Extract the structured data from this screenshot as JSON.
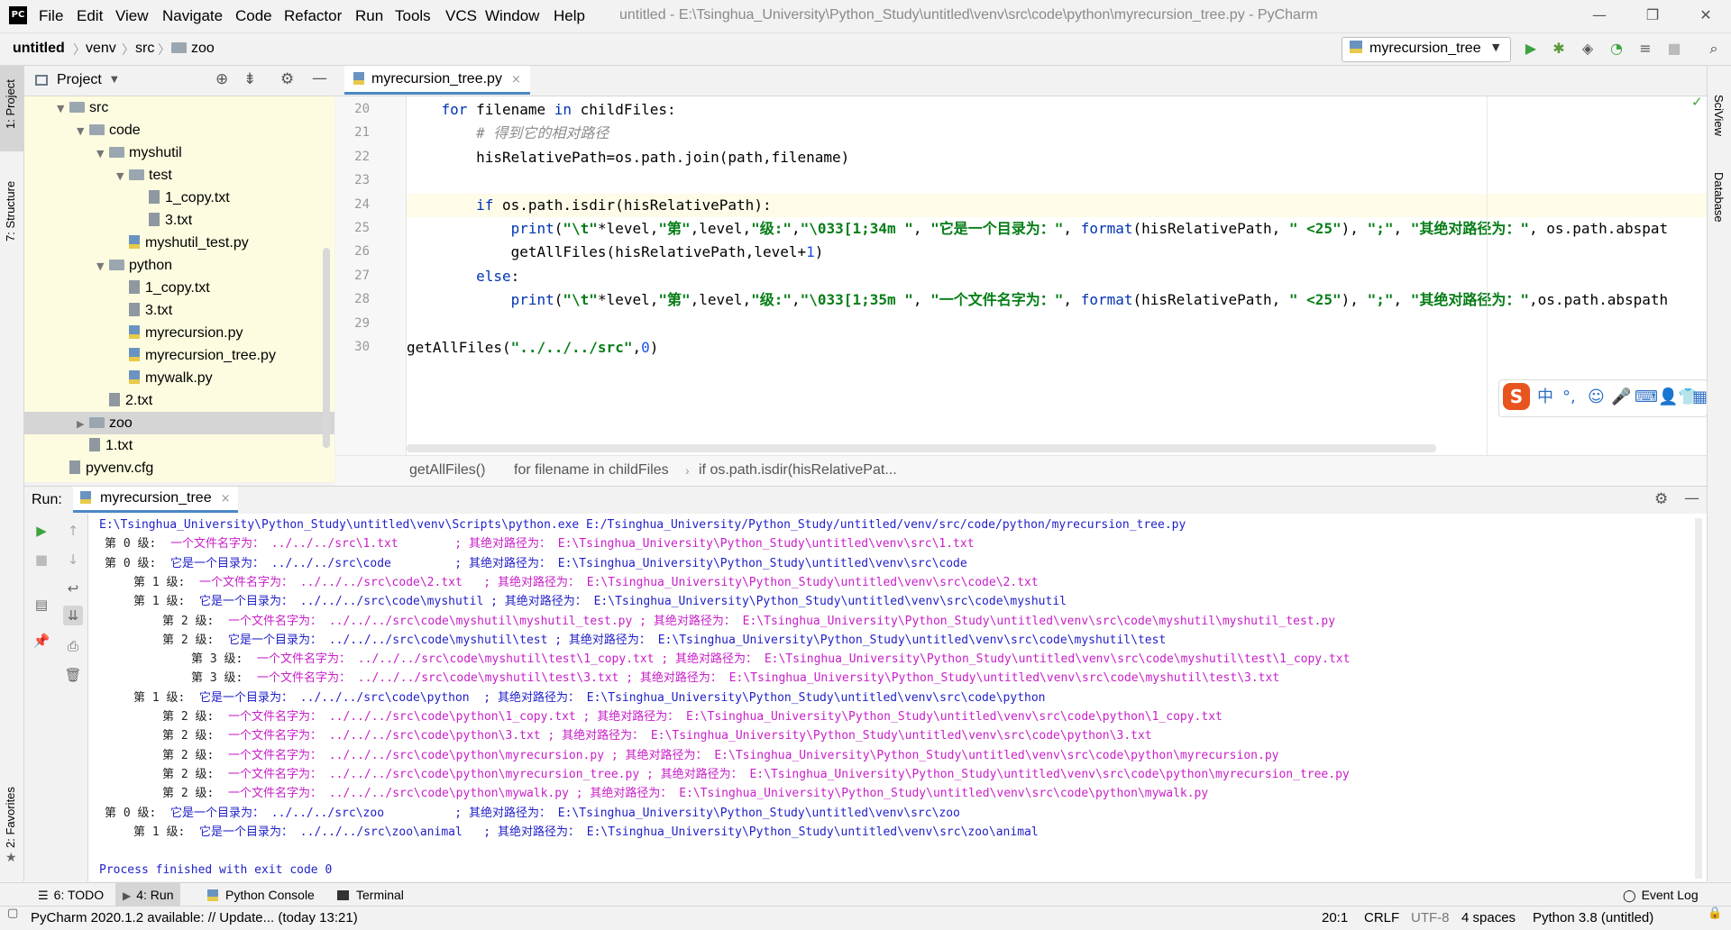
{
  "window": {
    "logo": "PC",
    "title": "untitled - E:\\Tsinghua_University\\Python_Study\\untitled\\venv\\src\\code\\python\\myrecursion_tree.py - PyCharm",
    "menu": [
      "File",
      "Edit",
      "View",
      "Navigate",
      "Code",
      "Refactor",
      "Run",
      "Tools",
      "VCS",
      "Window",
      "Help"
    ]
  },
  "navbar": {
    "crumbs": [
      "untitled",
      "venv",
      "src",
      "zoo"
    ],
    "run_config": "myrecursion_tree"
  },
  "left_stripe": {
    "project": "1: Project",
    "structure": "7: Structure",
    "favorites": "2: Favorites"
  },
  "right_stripe": {
    "sciview": "SciView",
    "database": "Database"
  },
  "project": {
    "title": "Project",
    "tree": [
      {
        "label": "src",
        "depth": 3,
        "type": "folder",
        "open": true
      },
      {
        "label": "code",
        "depth": 4,
        "type": "folder",
        "open": true
      },
      {
        "label": "myshutil",
        "depth": 5,
        "type": "folder",
        "open": true
      },
      {
        "label": "test",
        "depth": 6,
        "type": "folder",
        "open": true
      },
      {
        "label": "1_copy.txt",
        "depth": 7,
        "type": "txt"
      },
      {
        "label": "3.txt",
        "depth": 7,
        "type": "txt"
      },
      {
        "label": "myshutil_test.py",
        "depth": 6,
        "type": "py"
      },
      {
        "label": "python",
        "depth": 5,
        "type": "folder",
        "open": true
      },
      {
        "label": "1_copy.txt",
        "depth": 6,
        "type": "txt"
      },
      {
        "label": "3.txt",
        "depth": 6,
        "type": "txt"
      },
      {
        "label": "myrecursion.py",
        "depth": 6,
        "type": "py"
      },
      {
        "label": "myrecursion_tree.py",
        "depth": 6,
        "type": "py"
      },
      {
        "label": "mywalk.py",
        "depth": 6,
        "type": "py"
      },
      {
        "label": "2.txt",
        "depth": 5,
        "type": "txt"
      },
      {
        "label": "zoo",
        "depth": 4,
        "type": "folder",
        "open": false,
        "selected": true
      },
      {
        "label": "1.txt",
        "depth": 4,
        "type": "txt"
      },
      {
        "label": "pyvenv.cfg",
        "depth": 3,
        "type": "cfg"
      }
    ]
  },
  "editor": {
    "tab": "myrecursion_tree.py",
    "line_numbers": [
      "20",
      "21",
      "22",
      "23",
      "24",
      "25",
      "26",
      "27",
      "28",
      "29",
      "30"
    ],
    "lines": [
      [
        {
          "t": "    "
        },
        {
          "t": "for",
          "c": "kw"
        },
        {
          "t": " filename "
        },
        {
          "t": "in",
          "c": "kw"
        },
        {
          "t": " childFiles:"
        }
      ],
      [
        {
          "t": "        "
        },
        {
          "t": "# 得到它的相对路径",
          "c": "cm"
        }
      ],
      [
        {
          "t": "        hisRelativePath=os.path.join(path,filename)"
        }
      ],
      [
        {
          "t": ""
        }
      ],
      [
        {
          "t": "        "
        },
        {
          "t": "if",
          "c": "kw"
        },
        {
          "t": " os.path.isdir(hisRelativePath):"
        }
      ],
      [
        {
          "t": "            "
        },
        {
          "t": "print",
          "c": "kw"
        },
        {
          "t": "("
        },
        {
          "t": "\"\\t\"",
          "c": "str"
        },
        {
          "t": "*level,"
        },
        {
          "t": "\"第\"",
          "c": "str"
        },
        {
          "t": ",level,"
        },
        {
          "t": "\"级:\"",
          "c": "str"
        },
        {
          "t": ","
        },
        {
          "t": "\"\\033[1;34m \"",
          "c": "str"
        },
        {
          "t": ", "
        },
        {
          "t": "\"它是一个目录为：\"",
          "c": "str"
        },
        {
          "t": ", "
        },
        {
          "t": "format",
          "c": "kw"
        },
        {
          "t": "(hisRelativePath, "
        },
        {
          "t": "\" <25\"",
          "c": "str"
        },
        {
          "t": "), "
        },
        {
          "t": "\";\"",
          "c": "str"
        },
        {
          "t": ", "
        },
        {
          "t": "\"其绝对路径为：\"",
          "c": "str"
        },
        {
          "t": ", os.path.abspat"
        }
      ],
      [
        {
          "t": "            getAllFiles(hisRelativePath,level+"
        },
        {
          "t": "1",
          "c": "num"
        },
        {
          "t": ")"
        }
      ],
      [
        {
          "t": "        "
        },
        {
          "t": "else",
          "c": "kw"
        },
        {
          "t": ":"
        }
      ],
      [
        {
          "t": "            "
        },
        {
          "t": "print",
          "c": "kw"
        },
        {
          "t": "("
        },
        {
          "t": "\"\\t\"",
          "c": "str"
        },
        {
          "t": "*level,"
        },
        {
          "t": "\"第\"",
          "c": "str"
        },
        {
          "t": ",level,"
        },
        {
          "t": "\"级:\"",
          "c": "str"
        },
        {
          "t": ","
        },
        {
          "t": "\"\\033[1;35m \"",
          "c": "str"
        },
        {
          "t": ", "
        },
        {
          "t": "\"一个文件名字为：\"",
          "c": "str"
        },
        {
          "t": ", "
        },
        {
          "t": "format",
          "c": "kw"
        },
        {
          "t": "(hisRelativePath, "
        },
        {
          "t": "\" <25\"",
          "c": "str"
        },
        {
          "t": "), "
        },
        {
          "t": "\";\"",
          "c": "str"
        },
        {
          "t": ", "
        },
        {
          "t": "\"其绝对路径为：\"",
          "c": "str"
        },
        {
          "t": ",os.path.abspath"
        }
      ],
      [
        {
          "t": ""
        }
      ],
      [
        {
          "t": "getAllFiles("
        },
        {
          "t": "\"../../../src\"",
          "c": "str"
        },
        {
          "t": ","
        },
        {
          "t": "0",
          "c": "num"
        },
        {
          "t": ")"
        }
      ]
    ],
    "breadcrumbs": [
      "getAllFiles()",
      "for filename in childFiles",
      "if os.path.isdir(hisRelativePat..."
    ]
  },
  "ime": {
    "logo": "S",
    "items": [
      "中",
      "°,",
      "☺",
      "🎤",
      "⌨",
      "👤",
      "👕",
      "▦"
    ]
  },
  "run": {
    "label": "Run:",
    "tab": "myrecursion_tree",
    "output": [
      {
        "indent": 0,
        "color": "dark",
        "text": "E:\\Tsinghua_University\\Python_Study\\untitled\\venv\\Scripts\\python.exe E:/Tsinghua_University/Python_Study/untitled/venv/src/code/python/myrecursion_tree.py"
      },
      {
        "indent": 0,
        "color": "mag",
        "lvl": "第 0 级:",
        "text": "  一个文件名字为： ../../../src\\1.txt        ; 其绝对路径为： E:\\Tsinghua_University\\Python_Study\\untitled\\venv\\src\\1.txt"
      },
      {
        "indent": 0,
        "color": "blue",
        "lvl": "第 0 级:",
        "text": "  它是一个目录为： ../../../src\\code         ; 其绝对路径为： E:\\Tsinghua_University\\Python_Study\\untitled\\venv\\src\\code"
      },
      {
        "indent": 1,
        "color": "mag",
        "lvl": "第 1 级:",
        "text": "  一个文件名字为： ../../../src\\code\\2.txt   ; 其绝对路径为： E:\\Tsinghua_University\\Python_Study\\untitled\\venv\\src\\code\\2.txt"
      },
      {
        "indent": 1,
        "color": "blue",
        "lvl": "第 1 级:",
        "text": "  它是一个目录为： ../../../src\\code\\myshutil ; 其绝对路径为： E:\\Tsinghua_University\\Python_Study\\untitled\\venv\\src\\code\\myshutil"
      },
      {
        "indent": 2,
        "color": "mag",
        "lvl": "第 2 级:",
        "text": "  一个文件名字为： ../../../src\\code\\myshutil\\myshutil_test.py ; 其绝对路径为： E:\\Tsinghua_University\\Python_Study\\untitled\\venv\\src\\code\\myshutil\\myshutil_test.py"
      },
      {
        "indent": 2,
        "color": "blue",
        "lvl": "第 2 级:",
        "text": "  它是一个目录为： ../../../src\\code\\myshutil\\test ; 其绝对路径为： E:\\Tsinghua_University\\Python_Study\\untitled\\venv\\src\\code\\myshutil\\test"
      },
      {
        "indent": 3,
        "color": "mag",
        "lvl": "第 3 级:",
        "text": "  一个文件名字为： ../../../src\\code\\myshutil\\test\\1_copy.txt ; 其绝对路径为： E:\\Tsinghua_University\\Python_Study\\untitled\\venv\\src\\code\\myshutil\\test\\1_copy.txt"
      },
      {
        "indent": 3,
        "color": "mag",
        "lvl": "第 3 级:",
        "text": "  一个文件名字为： ../../../src\\code\\myshutil\\test\\3.txt ; 其绝对路径为： E:\\Tsinghua_University\\Python_Study\\untitled\\venv\\src\\code\\myshutil\\test\\3.txt"
      },
      {
        "indent": 1,
        "color": "blue",
        "lvl": "第 1 级:",
        "text": "  它是一个目录为： ../../../src\\code\\python  ; 其绝对路径为： E:\\Tsinghua_University\\Python_Study\\untitled\\venv\\src\\code\\python"
      },
      {
        "indent": 2,
        "color": "mag",
        "lvl": "第 2 级:",
        "text": "  一个文件名字为： ../../../src\\code\\python\\1_copy.txt ; 其绝对路径为： E:\\Tsinghua_University\\Python_Study\\untitled\\venv\\src\\code\\python\\1_copy.txt"
      },
      {
        "indent": 2,
        "color": "mag",
        "lvl": "第 2 级:",
        "text": "  一个文件名字为： ../../../src\\code\\python\\3.txt ; 其绝对路径为： E:\\Tsinghua_University\\Python_Study\\untitled\\venv\\src\\code\\python\\3.txt"
      },
      {
        "indent": 2,
        "color": "mag",
        "lvl": "第 2 级:",
        "text": "  一个文件名字为： ../../../src\\code\\python\\myrecursion.py ; 其绝对路径为： E:\\Tsinghua_University\\Python_Study\\untitled\\venv\\src\\code\\python\\myrecursion.py"
      },
      {
        "indent": 2,
        "color": "mag",
        "lvl": "第 2 级:",
        "text": "  一个文件名字为： ../../../src\\code\\python\\myrecursion_tree.py ; 其绝对路径为： E:\\Tsinghua_University\\Python_Study\\untitled\\venv\\src\\code\\python\\myrecursion_tree.py"
      },
      {
        "indent": 2,
        "color": "mag",
        "lvl": "第 2 级:",
        "text": "  一个文件名字为： ../../../src\\code\\python\\mywalk.py ; 其绝对路径为： E:\\Tsinghua_University\\Python_Study\\untitled\\venv\\src\\code\\python\\mywalk.py"
      },
      {
        "indent": 0,
        "color": "blue",
        "lvl": "第 0 级:",
        "text": "  它是一个目录为： ../../../src\\zoo          ; 其绝对路径为： E:\\Tsinghua_University\\Python_Study\\untitled\\venv\\src\\zoo"
      },
      {
        "indent": 1,
        "color": "blue",
        "lvl": "第 1 级:",
        "text": "  它是一个目录为： ../../../src\\zoo\\animal   ; 其绝对路径为： E:\\Tsinghua_University\\Python_Study\\untitled\\venv\\src\\zoo\\animal"
      },
      {
        "indent": 0,
        "color": "dark",
        "text": ""
      },
      {
        "indent": 0,
        "color": "dark",
        "text": "Process finished with exit code 0"
      }
    ]
  },
  "bottom_tabs": [
    "6: TODO",
    "4: Run",
    "Python Console",
    "Terminal"
  ],
  "event_log": "Event Log",
  "status": {
    "message": "PyCharm 2020.1.2 available: // Update... (today 13:21)",
    "position": "20:1",
    "line_sep": "CRLF",
    "encoding": "UTF-8",
    "indent": "4 spaces",
    "interpreter": "Python 3.8 (untitled)"
  },
  "colors": {
    "accent": "#4a88c7",
    "tree_bg": "#fefce0",
    "console_blue": "#1f1fc8",
    "console_magenta": "#c81ec8",
    "run_green": "#3ea33e"
  }
}
